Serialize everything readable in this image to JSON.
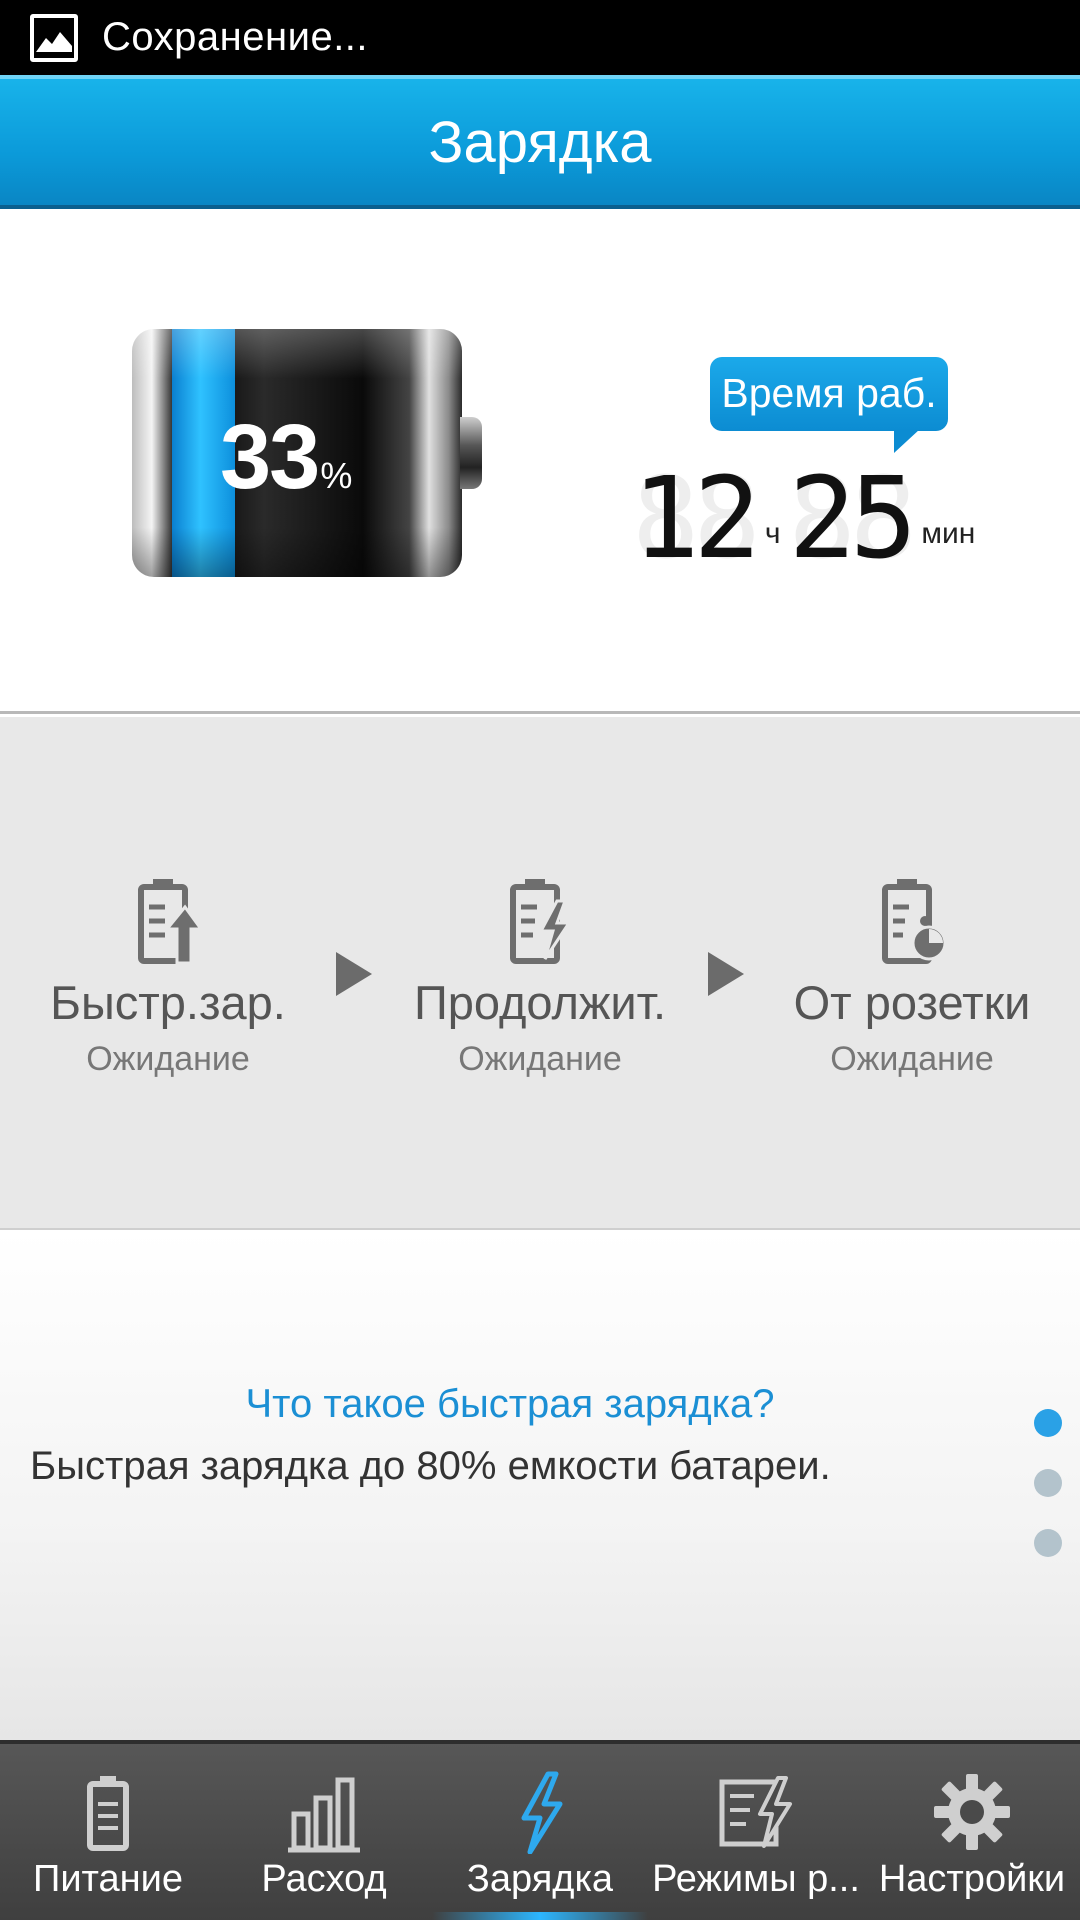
{
  "status_bar": {
    "text": "Сохранение...",
    "icon": "image-icon"
  },
  "header": {
    "title": "Зарядка"
  },
  "battery": {
    "percent_value": "33",
    "percent_sign": "%",
    "level_fraction": 0.33
  },
  "runtime": {
    "label": "Время раб.",
    "hours": "12",
    "hours_unit": "ч",
    "minutes": "25",
    "minutes_unit": "мин"
  },
  "charge_steps": [
    {
      "title": "Быстр.зар.",
      "status": "Ожидание",
      "icon": "battery-fast-charge-icon"
    },
    {
      "title": "Продолжит.",
      "status": "Ожидание",
      "icon": "battery-continuous-charge-icon"
    },
    {
      "title": "От розетки",
      "status": "Ожидание",
      "icon": "battery-trickle-charge-icon"
    }
  ],
  "tip": {
    "question": "Что такое быстрая зарядка?",
    "answer": "Быстрая зарядка до 80% емкости батареи.",
    "pages": 3,
    "active_page": 1
  },
  "bottom_nav": [
    {
      "label": "Питание",
      "icon": "battery-icon",
      "active": false
    },
    {
      "label": "Расход",
      "icon": "bar-chart-icon",
      "active": false
    },
    {
      "label": "Зарядка",
      "icon": "lightning-icon",
      "active": true
    },
    {
      "label": "Режимы р...",
      "icon": "modes-icon",
      "active": false
    },
    {
      "label": "Настройки",
      "icon": "gear-icon",
      "active": false
    }
  ],
  "colors": {
    "accent": "#0c9ad9",
    "header_bg": "#18b3ea",
    "nav_bg": "#4a4a4a",
    "link": "#1b8fd4"
  }
}
